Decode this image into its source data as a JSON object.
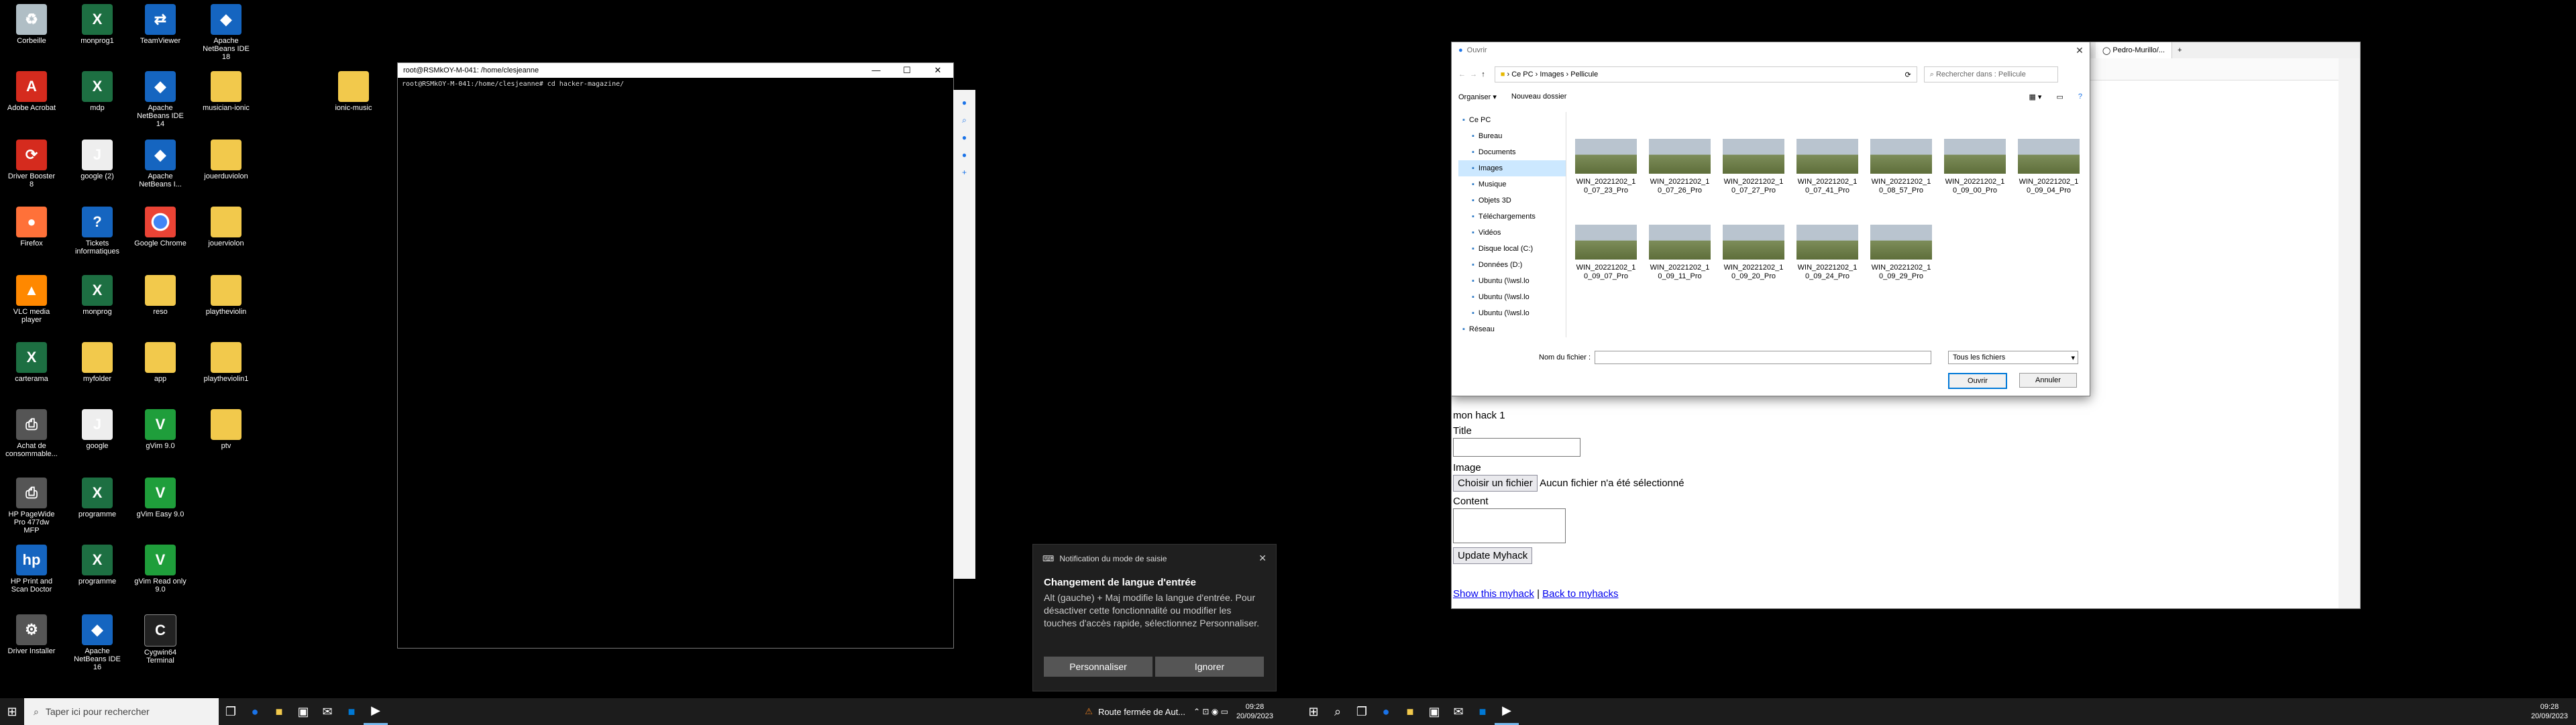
{
  "desktop": {
    "icons": [
      {
        "label": "Corbeille",
        "icon": "recycle-bin-icon"
      },
      {
        "label": "monprog1",
        "icon": "excel-file-icon"
      },
      {
        "label": "TeamViewer",
        "icon": "teamviewer-icon"
      },
      {
        "label": "Apache NetBeans IDE 18",
        "icon": "netbeans-icon"
      },
      {
        "label": "Adobe Acrobat",
        "icon": "acrobat-icon"
      },
      {
        "label": "mdp",
        "icon": "excel-file-icon"
      },
      {
        "label": "Apache NetBeans IDE 14",
        "icon": "netbeans-icon"
      },
      {
        "label": "musician-ionic",
        "icon": "folder-icon"
      },
      {
        "label": "ionic-music",
        "icon": "folder-icon"
      },
      {
        "label": "Driver Booster 8",
        "icon": "driver-booster-icon"
      },
      {
        "label": "google (2)",
        "icon": "java-file-icon"
      },
      {
        "label": "Apache NetBeans I...",
        "icon": "netbeans-icon"
      },
      {
        "label": "jouerduviolon",
        "icon": "folder-icon"
      },
      {
        "label": "Firefox",
        "icon": "firefox-icon"
      },
      {
        "label": "Tickets informatiques",
        "icon": "help-icon"
      },
      {
        "label": "Google Chrome",
        "icon": "chrome-icon"
      },
      {
        "label": "jouerviolon",
        "icon": "folder-icon"
      },
      {
        "label": "VLC media player",
        "icon": "vlc-icon"
      },
      {
        "label": "monprog",
        "icon": "excel-file-icon"
      },
      {
        "label": "reso",
        "icon": "folder-icon"
      },
      {
        "label": "playtheviolin",
        "icon": "folder-icon"
      },
      {
        "label": "carterama",
        "icon": "excel-file-icon"
      },
      {
        "label": "myfolder",
        "icon": "folder-icon"
      },
      {
        "label": "app",
        "icon": "folder-icon"
      },
      {
        "label": "playtheviolin1",
        "icon": "folder-icon"
      },
      {
        "label": "Achat de consommable...",
        "icon": "printer-icon"
      },
      {
        "label": "google",
        "icon": "java-file-icon"
      },
      {
        "label": "gVim 9.0",
        "icon": "vim-icon"
      },
      {
        "label": "ptv",
        "icon": "folder-icon"
      },
      {
        "label": "HP PageWide Pro 477dw MFP",
        "icon": "printer-icon"
      },
      {
        "label": "programme",
        "icon": "excel-file-icon"
      },
      {
        "label": "gVim Easy 9.0",
        "icon": "vim-icon"
      },
      {
        "label": "HP Print and Scan Doctor",
        "icon": "hp-icon"
      },
      {
        "label": "programme",
        "icon": "excel-file-icon"
      },
      {
        "label": "gVim Read only 9.0",
        "icon": "vim-icon"
      },
      {
        "label": "Driver Installer",
        "icon": "driver-installer-icon"
      },
      {
        "label": "Apache NetBeans IDE 16",
        "icon": "netbeans-icon"
      },
      {
        "label": "Cygwin64 Terminal",
        "icon": "terminal-icon"
      }
    ]
  },
  "terminal": {
    "title": "root@RSMkOY-M-041: /home/clesjeanne",
    "line": "root@RSMkOY-M-041:/home/clesjeanne# cd hacker-magazine/",
    "controls": [
      "—",
      "☐",
      "✕"
    ]
  },
  "browser": {
    "tabs": [
      "Pedro-Murillo/..."
    ],
    "form": {
      "heading": "mon hack 1",
      "title_label": "Title",
      "image_label": "Image",
      "file_button": "Choisir un fichier",
      "file_status": "Aucun fichier n'a été sélectionné",
      "content_label": "Content",
      "submit": "Update Myhack",
      "link_show": "Show this myhack",
      "separator": "|",
      "link_back": "Back to myhacks"
    }
  },
  "dialog": {
    "title": "Ouvrir",
    "breadcrumb": [
      "Ce PC",
      "Images",
      "Pellicule"
    ],
    "search_placeholder": "Rechercher dans : Pellicule",
    "organize": "Organiser",
    "new_folder": "Nouveau dossier",
    "nav_items": [
      "Ce PC",
      "Bureau",
      "Documents",
      "Images",
      "Musique",
      "Objets 3D",
      "Téléchargements",
      "Vidéos",
      "Disque local (C:)",
      "Données (D:)",
      "Ubuntu (\\\\wsl.lo",
      "Ubuntu (\\\\wsl.lo",
      "Ubuntu (\\\\wsl.lo",
      "Réseau"
    ],
    "selected_nav": "Images",
    "files": [
      {
        "l1": "WIN_20221202_1",
        "l2": "0_07_23_Pro"
      },
      {
        "l1": "WIN_20221202_1",
        "l2": "0_07_26_Pro"
      },
      {
        "l1": "WIN_20221202_1",
        "l2": "0_07_27_Pro"
      },
      {
        "l1": "WIN_20221202_1",
        "l2": "0_07_41_Pro"
      },
      {
        "l1": "WIN_20221202_1",
        "l2": "0_08_57_Pro"
      },
      {
        "l1": "WIN_20221202_1",
        "l2": "0_09_00_Pro"
      },
      {
        "l1": "WIN_20221202_1",
        "l2": "0_09_04_Pro"
      },
      {
        "l1": "WIN_20221202_1",
        "l2": "0_09_07_Pro"
      },
      {
        "l1": "WIN_20221202_1",
        "l2": "0_09_11_Pro"
      },
      {
        "l1": "WIN_20221202_1",
        "l2": "0_09_20_Pro"
      },
      {
        "l1": "WIN_20221202_1",
        "l2": "0_09_24_Pro"
      },
      {
        "l1": "WIN_20221202_1",
        "l2": "0_09_29_Pro"
      }
    ],
    "filename_label": "Nom du fichier :",
    "filetype": "Tous les fichiers",
    "open": "Ouvrir",
    "cancel": "Annuler"
  },
  "notification": {
    "app": "Notification du mode de saisie",
    "title": "Changement de langue d'entrée",
    "body": "Alt (gauche) + Maj modifie la langue d'entrée. Pour désactiver cette fonctionnalité ou modifier les touches d'accès rapide, sélectionnez Personnaliser.",
    "customize": "Personnaliser",
    "ignore": "Ignorer"
  },
  "taskbar_left": {
    "search_placeholder": "Taper ici pour rechercher",
    "weather": "Route fermée de Aut...",
    "time": "09:28",
    "date": "20/09/2023"
  },
  "taskbar_right": {
    "time": "09:28",
    "date": "20/09/2023"
  }
}
